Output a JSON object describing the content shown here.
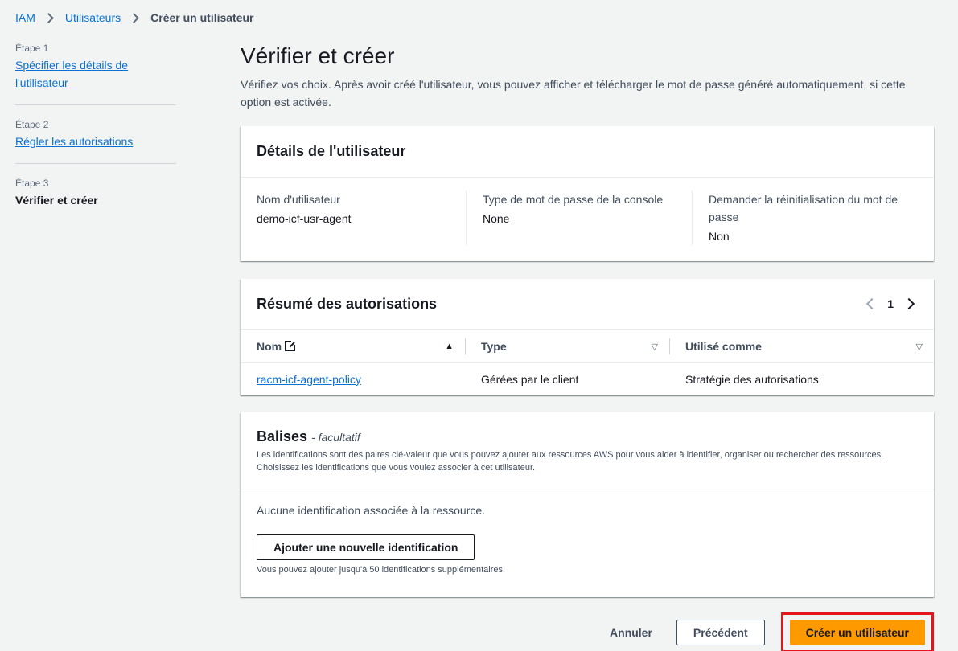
{
  "breadcrumb": {
    "items": [
      "IAM",
      "Utilisateurs"
    ],
    "current": "Créer un utilisateur"
  },
  "steps": [
    {
      "num": "Étape 1",
      "label": "Spécifier les détails de l'utilisateur"
    },
    {
      "num": "Étape 2",
      "label": "Régler les autorisations"
    },
    {
      "num": "Étape 3",
      "label": "Vérifier et créer"
    }
  ],
  "page": {
    "title": "Vérifier et créer",
    "description": "Vérifiez vos choix. Après avoir créé l'utilisateur, vous pouvez afficher et télécharger le mot de passe généré automatiquement, si cette option est activée."
  },
  "details": {
    "title": "Détails de l'utilisateur",
    "fields": [
      {
        "key": "Nom d'utilisateur",
        "value": "demo-icf-usr-agent"
      },
      {
        "key": "Type de mot de passe de la console",
        "value": "None"
      },
      {
        "key": "Demander la réinitialisation du mot de passe",
        "value": "Non"
      }
    ]
  },
  "permissions": {
    "title": "Résumé des autorisations",
    "page": "1",
    "columns": [
      "Nom",
      "Type",
      "Utilisé comme"
    ],
    "rows": [
      {
        "name": "racm-icf-agent-policy",
        "type": "Gérées par le client",
        "used_as": "Stratégie des autorisations"
      }
    ]
  },
  "tags": {
    "title": "Balises",
    "optional": "- facultatif",
    "description": "Les identifications sont des paires clé-valeur que vous pouvez ajouter aux ressources AWS pour vous aider à identifier, organiser ou rechercher des ressources. Choisissez les identifications que vous voulez associer à cet utilisateur.",
    "empty": "Aucune identification associée à la ressource.",
    "add_button": "Ajouter une nouvelle identification",
    "hint": "Vous pouvez ajouter jusqu'à 50 identifications supplémentaires."
  },
  "footer": {
    "cancel": "Annuler",
    "previous": "Précédent",
    "create": "Créer un utilisateur"
  },
  "colors": {
    "link": "#0972d3",
    "primary": "#ff9900",
    "highlight": "#e4161b"
  }
}
